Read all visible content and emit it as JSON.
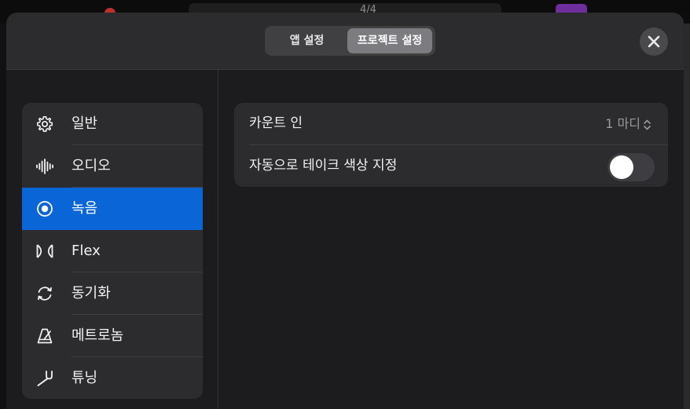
{
  "header": {
    "tabs": [
      {
        "label": "앱 설정",
        "selected": false
      },
      {
        "label": "프로젝트 설정",
        "selected": true
      }
    ],
    "background_lcd_text": "4/4"
  },
  "sidebar": {
    "items": [
      {
        "label": "일반",
        "icon": "gear-icon"
      },
      {
        "label": "오디오",
        "icon": "waveform-icon"
      },
      {
        "label": "녹음",
        "icon": "record-icon",
        "selected": true
      },
      {
        "label": "Flex",
        "icon": "flex-icon"
      },
      {
        "label": "동기화",
        "icon": "sync-icon"
      },
      {
        "label": "메트로놈",
        "icon": "metronome-icon"
      },
      {
        "label": "튜닝",
        "icon": "tuning-fork-icon"
      }
    ]
  },
  "settings": {
    "count_in": {
      "label": "카운트 인",
      "value": "1 마디"
    },
    "auto_take_color": {
      "label": "자동으로 테이크 색상 지정",
      "enabled": false
    }
  },
  "colors": {
    "accent": "#0a66d6",
    "sheet": "#1c1c1e",
    "card": "#2c2c2e"
  }
}
